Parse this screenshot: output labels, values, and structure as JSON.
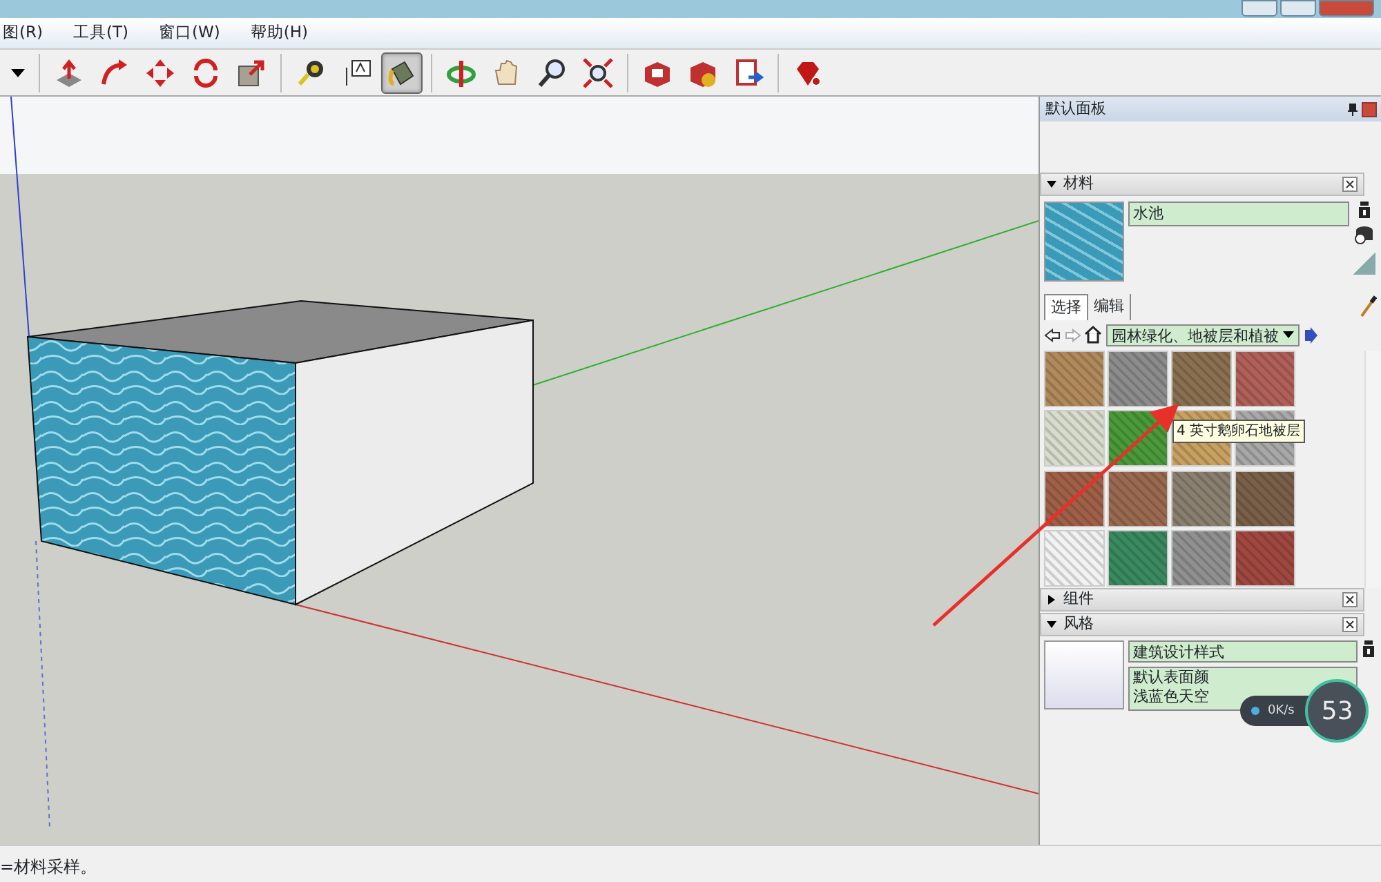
{
  "menu": [
    "图(R)",
    "工具(T)",
    "窗口(W)",
    "帮助(H)"
  ],
  "toolbar": [
    [
      {
        "kind": "dropdown"
      }
    ],
    [
      {
        "kind": "pushpull",
        "selected": false
      },
      {
        "kind": "followme",
        "selected": false
      },
      {
        "kind": "move",
        "selected": false
      },
      {
        "kind": "rotate",
        "selected": false
      },
      {
        "kind": "scale",
        "selected": false
      }
    ],
    [
      {
        "kind": "tape",
        "selected": false
      },
      {
        "kind": "text",
        "selected": false
      },
      {
        "kind": "paint",
        "selected": true
      }
    ],
    [
      {
        "kind": "orbit",
        "selected": false
      },
      {
        "kind": "pan",
        "selected": false
      },
      {
        "kind": "zoom",
        "selected": false
      },
      {
        "kind": "extents",
        "selected": false
      }
    ],
    [
      {
        "kind": "warehouse",
        "selected": false
      },
      {
        "kind": "share",
        "selected": false
      },
      {
        "kind": "upload",
        "selected": false
      }
    ],
    [
      {
        "kind": "ruby",
        "selected": false
      }
    ]
  ],
  "tray": {
    "title": "默认面板",
    "materials": {
      "title": "材料",
      "expanded": true,
      "name": "水池",
      "tabs": [
        {
          "label": "选择",
          "selected": true
        },
        {
          "label": "编辑",
          "selected": false
        }
      ],
      "collection": "园林绿化、地被层和植被",
      "swatches": [
        {
          "color": "#b08a5a"
        },
        {
          "color": "#8c8c8c"
        },
        {
          "color": "#8a7050"
        },
        {
          "color": "#b06058"
        },
        {
          "color": "#d8dccc"
        },
        {
          "color": "#4a9a3a"
        },
        {
          "color": "#c8a060"
        },
        {
          "color": "#a8a8a8"
        },
        {
          "color": "#a06048"
        },
        {
          "color": "#9a6a50"
        },
        {
          "color": "#8a8070"
        },
        {
          "color": "#7a6048"
        },
        {
          "color": "#f2f2f2"
        },
        {
          "color": "#3a8a60"
        },
        {
          "color": "#909090"
        },
        {
          "color": "#a04840"
        }
      ],
      "tooltip": "4 英寸鹅卵石地被层"
    },
    "components": {
      "title": "组件",
      "expanded": false
    },
    "styles": {
      "title": "风格",
      "expanded": true,
      "name": "建筑设计样式",
      "description": [
        "默认表面颜",
        "浅蓝色天空"
      ]
    }
  },
  "speed_widget": {
    "rate": "0K/s",
    "percent": "53"
  },
  "status_bar": "=材料采样。"
}
